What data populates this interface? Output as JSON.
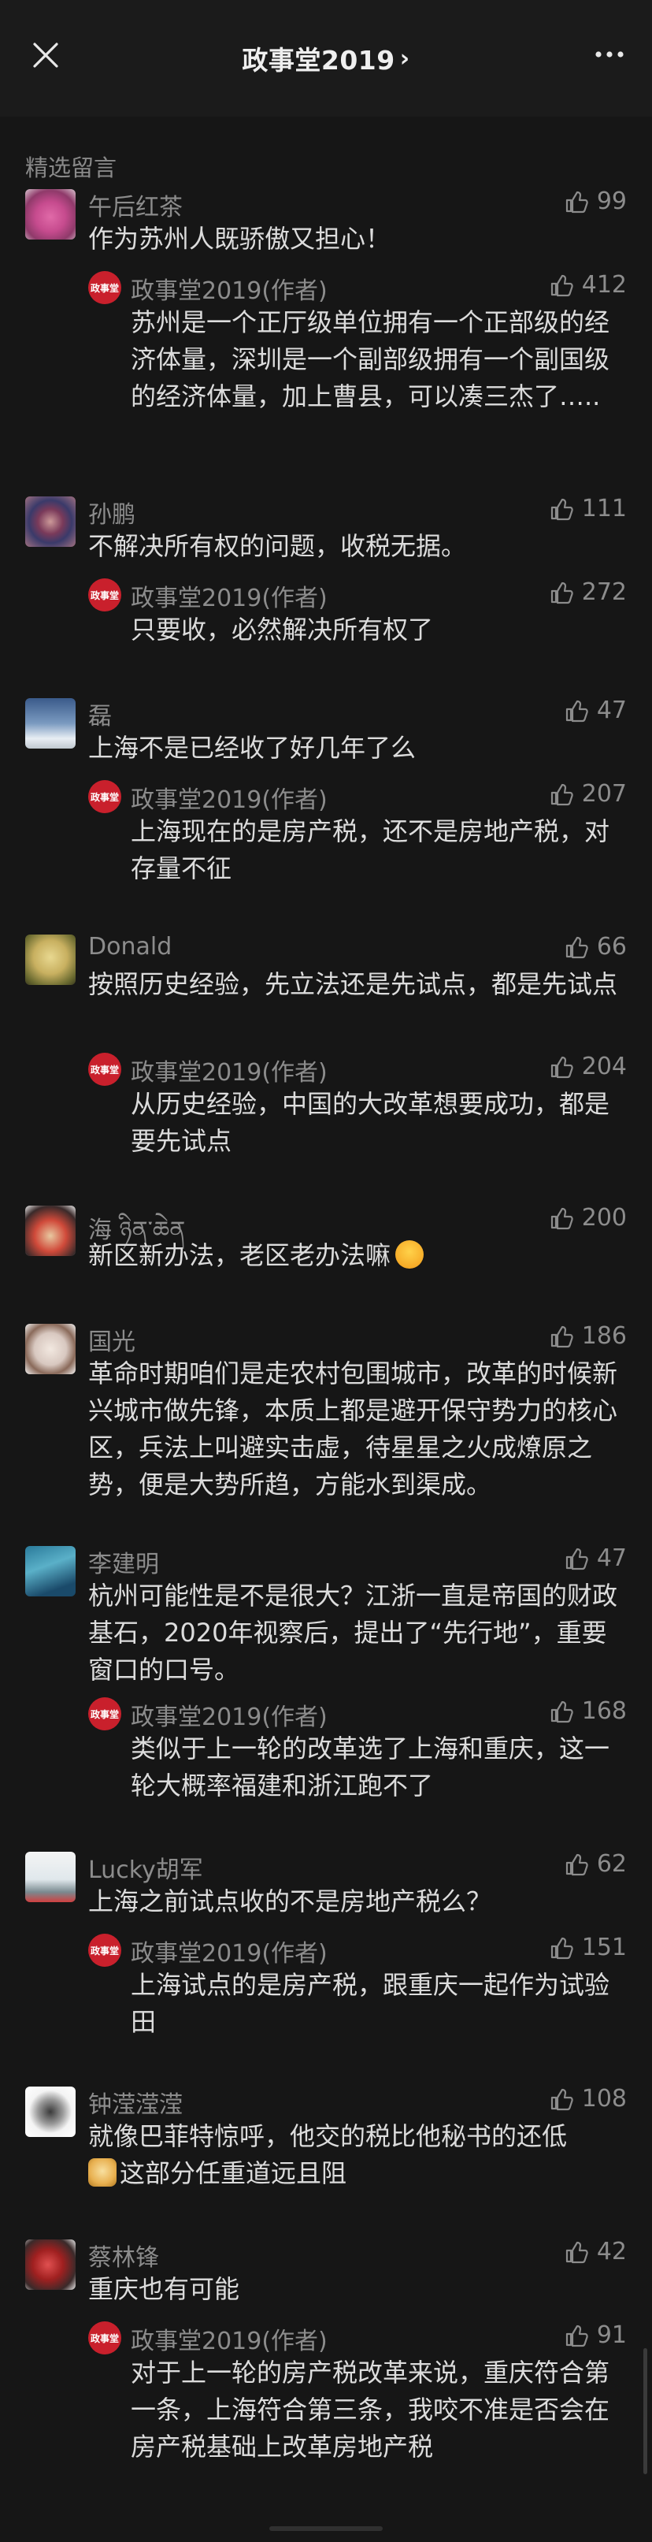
{
  "header": {
    "title": "政事堂2019",
    "chevron": "›"
  },
  "section_label": "精选留言",
  "comments": [
    {
      "name": "午后红茶",
      "likes": "99",
      "text": "作为苏州人既骄傲又担心！",
      "reply": {
        "name": "政事堂2019(作者)",
        "likes": "412",
        "text": "苏州是一个正厅级单位拥有一个正部级的经济体量，深圳是一个副部级拥有一个副国级的经济体量，加上曹县，可以凑三杰了….."
      }
    },
    {
      "name": "孙鹏",
      "likes": "111",
      "text": "不解决所有权的问题，收税无据。",
      "reply": {
        "name": "政事堂2019(作者)",
        "likes": "272",
        "text": "只要收，必然解决所有权了"
      }
    },
    {
      "name": "磊",
      "likes": "47",
      "text": "上海不是已经收了好几年了么",
      "reply": {
        "name": "政事堂2019(作者)",
        "likes": "207",
        "text": "上海现在的是房产税，还不是房地产税，对存量不征"
      }
    },
    {
      "name": "Donald",
      "likes": "66",
      "text": "按照历史经验，先立法还是先试点，都是先试点",
      "reply": {
        "name": "政事堂2019(作者)",
        "likes": "204",
        "text": "从历史经验，中国的大改革想要成功，都是要先试点"
      }
    },
    {
      "name": "海 ཉིན་ཆེན",
      "likes": "200",
      "text": "新区新办法，老区老办法嘛"
    },
    {
      "name": "国光",
      "likes": "186",
      "text": "革命时期咱们是走农村包围城市，改革的时候新兴城市做先锋，本质上都是避开保守势力的核心区，兵法上叫避实击虚，待星星之火成燎原之势，便是大势所趋，方能水到渠成。"
    },
    {
      "name": "李建明",
      "likes": "47",
      "text": "杭州可能性是不是很大？江浙一直是帝国的财政基石，2020年视察后，提出了“先行地”，重要窗口的口号。",
      "reply": {
        "name": "政事堂2019(作者)",
        "likes": "168",
        "text": "类似于上一轮的改革选了上海和重庆，这一轮大概率福建和浙江跑不了"
      }
    },
    {
      "name": "Lucky胡军",
      "likes": "62",
      "text": "上海之前试点收的不是房地产税么？",
      "reply": {
        "name": "政事堂2019(作者)",
        "likes": "151",
        "text": "上海试点的是房产税，跟重庆一起作为试验田"
      }
    },
    {
      "name": "钟滢滢滢",
      "likes": "108",
      "text": "就像巴菲特惊呼，他交的税比他秘书的还低",
      "text2": "这部分任重道远且阻"
    },
    {
      "name": "蔡林锋",
      "likes": "42",
      "text": "重庆也有可能",
      "reply": {
        "name": "政事堂2019(作者)",
        "likes": "91",
        "text": "对于上一轮的房产税改革来说，重庆符合第一条，上海符合第三条，我咬不准是否会在房产税基础上改革房地产税"
      }
    }
  ],
  "reply_avatar_text": "政事堂",
  "colors": {
    "background": "#161616",
    "reply_avatar": "#c9202c"
  }
}
